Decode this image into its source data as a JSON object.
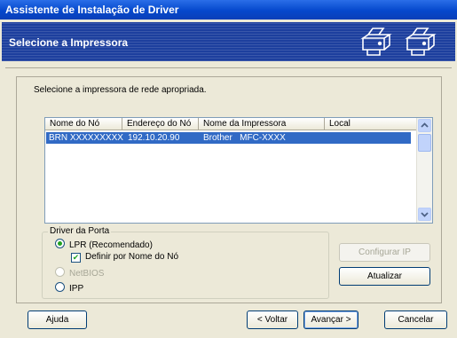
{
  "window": {
    "title": "Assistente de Instalação de Driver"
  },
  "banner": {
    "title": "Selecione a Impressora",
    "icons": [
      "printer-icon",
      "printer-icon"
    ]
  },
  "instruction": "Selecione a impressora de rede apropriada.",
  "printer_list": {
    "columns": [
      "Nome do Nó",
      "Endereço do Nó",
      "Nome da Impressora",
      "Local"
    ],
    "rows": [
      {
        "node_name": "BRN XXXXXXXXX",
        "node_address": "192.10.20.90",
        "printer_name": "Brother   MFC-XXXX",
        "location": ""
      }
    ]
  },
  "port_driver": {
    "title": "Driver da Porta",
    "options": [
      "LPR (Recomendado)",
      "NetBIOS",
      "IPP"
    ],
    "selected": "LPR (Recomendado)",
    "define_by_node_name": {
      "label": "Definir por Nome do Nó",
      "checked": true
    }
  },
  "buttons": {
    "configure_ip": "Configurar IP",
    "refresh": "Atualizar",
    "help": "Ajuda",
    "back": "< Voltar",
    "next": "Avançar >",
    "cancel": "Cancelar"
  },
  "colors": {
    "title_bar": "#0a46cc",
    "banner": "#1d3f9e",
    "selection": "#316ac5",
    "dialog_bg": "#ece9d8"
  }
}
